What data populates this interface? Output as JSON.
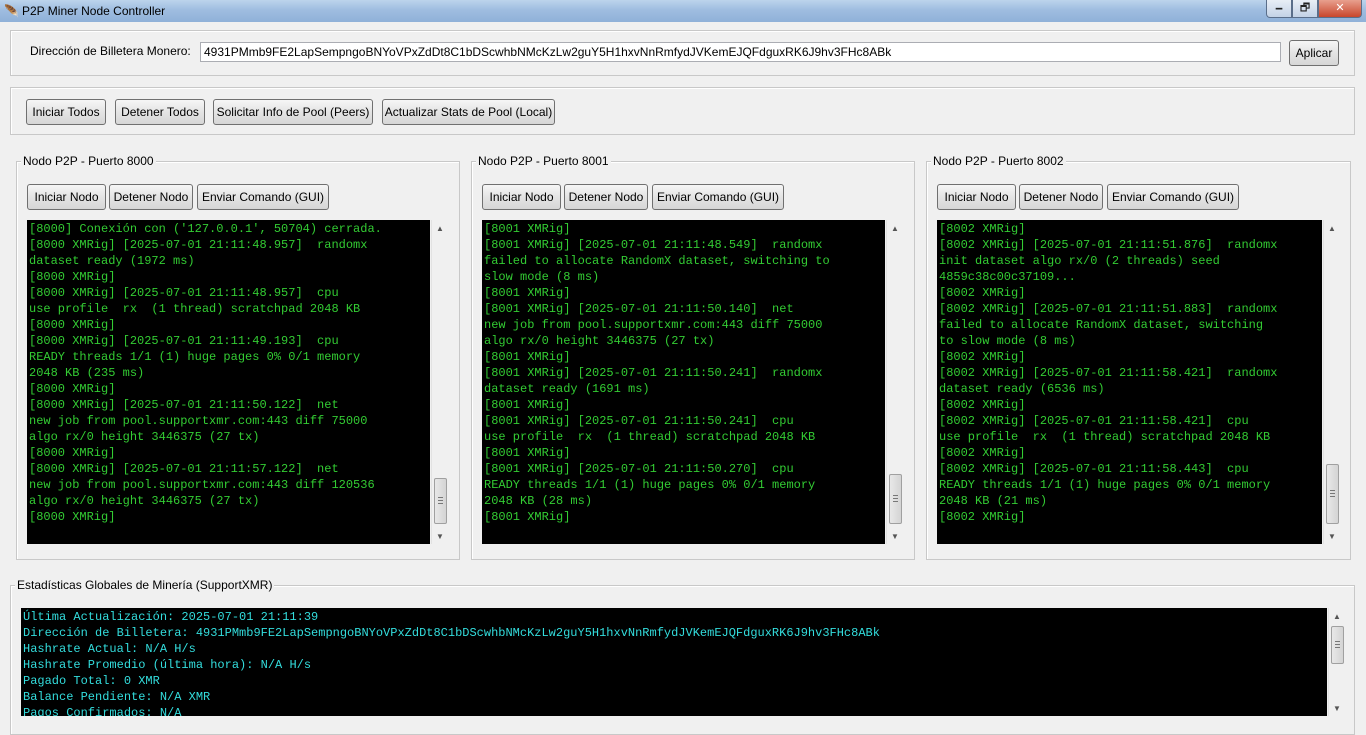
{
  "window": {
    "title": "P2P Miner Node Controller",
    "min_glyph": "🗕",
    "max_glyph": "🗗",
    "close_glyph": "✕",
    "app_icon_glyph": "🪶"
  },
  "wallet": {
    "label": "Dirección de Billetera Monero:",
    "value": "4931PMmb9FE2LapSempngoBNYoVPxZdDt8C1bDScwhbNMcKzLw2guY5H1hxvNnRmfydJVKemEJQFdguxRK6J9hv3FHc8ABk",
    "apply_label": "Aplicar"
  },
  "toolbar": {
    "start_all": "Iniciar Todos",
    "stop_all": "Detener Todos",
    "request_pool_info": "Solicitar Info de Pool (Peers)",
    "update_pool_stats": "Actualizar Stats de Pool (Local)"
  },
  "nodes": [
    {
      "title": "Nodo P2P - Puerto 8000",
      "start_label": "Iniciar Nodo",
      "stop_label": "Detener Nodo",
      "send_label": "Enviar Comando (GUI)",
      "log": [
        "[8000] Conexión con ('127.0.0.1', 50704) cerrada.",
        "[8000 XMRig] [2025-07-01 21:11:48.957]  randomx",
        "dataset ready (1972 ms)",
        "[8000 XMRig]",
        "[8000 XMRig] [2025-07-01 21:11:48.957]  cpu",
        "use profile  rx  (1 thread) scratchpad 2048 KB",
        "[8000 XMRig]",
        "[8000 XMRig] [2025-07-01 21:11:49.193]  cpu",
        "READY threads 1/1 (1) huge pages 0% 0/1 memory",
        "2048 KB (235 ms)",
        "[8000 XMRig]",
        "[8000 XMRig] [2025-07-01 21:11:50.122]  net",
        "new job from pool.supportxmr.com:443 diff 75000",
        "algo rx/0 height 3446375 (27 tx)",
        "[8000 XMRig]",
        "[8000 XMRig] [2025-07-01 21:11:57.122]  net",
        "new job from pool.supportxmr.com:443 diff 120536",
        "algo rx/0 height 3446375 (27 tx)",
        "[8000 XMRig]"
      ]
    },
    {
      "title": "Nodo P2P - Puerto 8001",
      "start_label": "Iniciar Nodo",
      "stop_label": "Detener Nodo",
      "send_label": "Enviar Comando (GUI)",
      "log": [
        "[8001 XMRig]",
        "[8001 XMRig] [2025-07-01 21:11:48.549]  randomx",
        "failed to allocate RandomX dataset, switching to",
        "slow mode (8 ms)",
        "[8001 XMRig]",
        "[8001 XMRig] [2025-07-01 21:11:50.140]  net",
        "new job from pool.supportxmr.com:443 diff 75000",
        "algo rx/0 height 3446375 (27 tx)",
        "[8001 XMRig]",
        "[8001 XMRig] [2025-07-01 21:11:50.241]  randomx",
        "dataset ready (1691 ms)",
        "[8001 XMRig]",
        "[8001 XMRig] [2025-07-01 21:11:50.241]  cpu",
        "use profile  rx  (1 thread) scratchpad 2048 KB",
        "[8001 XMRig]",
        "[8001 XMRig] [2025-07-01 21:11:50.270]  cpu",
        "READY threads 1/1 (1) huge pages 0% 0/1 memory",
        "2048 KB (28 ms)",
        "[8001 XMRig]"
      ]
    },
    {
      "title": "Nodo P2P - Puerto 8002",
      "start_label": "Iniciar Nodo",
      "stop_label": "Detener Nodo",
      "send_label": "Enviar Comando (GUI)",
      "log": [
        "[8002 XMRig]",
        "[8002 XMRig] [2025-07-01 21:11:51.876]  randomx",
        "init dataset algo rx/0 (2 threads) seed",
        "4859c38c00c37109...",
        "[8002 XMRig]",
        "[8002 XMRig] [2025-07-01 21:11:51.883]  randomx",
        "failed to allocate RandomX dataset, switching",
        "to slow mode (8 ms)",
        "[8002 XMRig]",
        "[8002 XMRig] [2025-07-01 21:11:58.421]  randomx",
        "dataset ready (6536 ms)",
        "[8002 XMRig]",
        "[8002 XMRig] [2025-07-01 21:11:58.421]  cpu",
        "use profile  rx  (1 thread) scratchpad 2048 KB",
        "[8002 XMRig]",
        "[8002 XMRig] [2025-07-01 21:11:58.443]  cpu",
        "READY threads 1/1 (1) huge pages 0% 0/1 memory",
        "2048 KB (21 ms)",
        "[8002 XMRig]"
      ]
    }
  ],
  "stats": {
    "title": "Estadísticas Globales de Minería (SupportXMR)",
    "lines": [
      "Última Actualización: 2025-07-01 21:11:39",
      "Dirección de Billetera: 4931PMmb9FE2LapSempngoBNYoVPxZdDt8C1bDScwhbNMcKzLw2guY5H1hxvNnRmfydJVKemEJQFdguxRK6J9hv3FHc8ABk",
      "Hashrate Actual: N/A H/s",
      "Hashrate Promedio (última hora): N/A H/s",
      "Pagado Total: 0 XMR",
      "Balance Pendiente: N/A XMR",
      "Pagos Confirmados: N/A"
    ]
  },
  "colors": {
    "log_text": "#33cc33",
    "stats_text": "#33dddd",
    "console_bg": "#000000"
  }
}
